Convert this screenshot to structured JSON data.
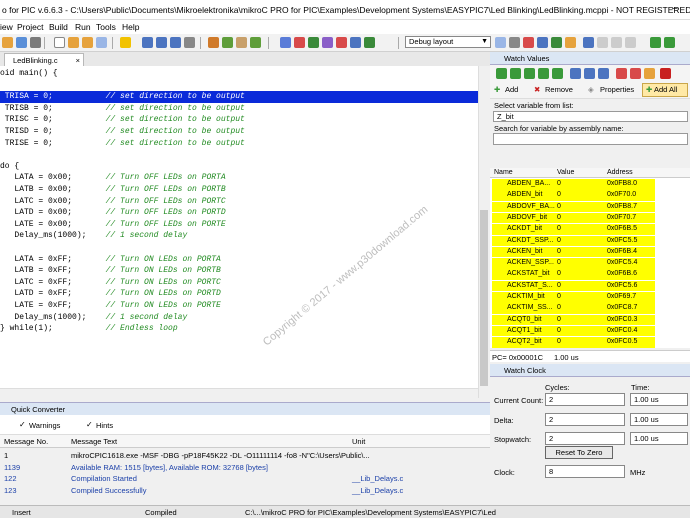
{
  "window": {
    "title": "o for PIC v.6.6.3 - C:\\Users\\Public\\Documents\\Mikroelektronika\\mikroC PRO for PIC\\Examples\\Development Systems\\EASYPIC7\\Led Blinking\\LedBlinking.mcppi - NOT REGISTERED"
  },
  "menu": [
    "iew",
    "Project",
    "Build",
    "Run",
    "Tools",
    "Help"
  ],
  "toolbar": {
    "layout_value": "Debug layout"
  },
  "editor": {
    "tab": "LedBlinking.c",
    "lines": [
      {
        "code": "oid main() {",
        "comment": ""
      },
      {
        "code": "",
        "comment": ""
      },
      {
        "code": " TRISA = 0;           ",
        "comment": "// set direction to be output"
      },
      {
        "code": " TRISB = 0;           ",
        "comment": "// set direction to be output"
      },
      {
        "code": " TRISC = 0;           ",
        "comment": "// set direction to be output"
      },
      {
        "code": " TRISD = 0;           ",
        "comment": "// set direction to be output"
      },
      {
        "code": " TRISE = 0;           ",
        "comment": "// set direction to be output"
      },
      {
        "code": "",
        "comment": ""
      },
      {
        "code": "do {",
        "comment": ""
      },
      {
        "code": "   LATA = 0x00;       ",
        "comment": "// Turn OFF LEDs on PORTA"
      },
      {
        "code": "   LATB = 0x00;       ",
        "comment": "// Turn OFF LEDs on PORTB"
      },
      {
        "code": "   LATC = 0x00;       ",
        "comment": "// Turn OFF LEDs on PORTC"
      },
      {
        "code": "   LATD = 0x00;       ",
        "comment": "// Turn OFF LEDs on PORTD"
      },
      {
        "code": "   LATE = 0x00;       ",
        "comment": "// Turn OFF LEDs on PORTE"
      },
      {
        "code": "   Delay_ms(1000);    ",
        "comment": "// 1 second delay"
      },
      {
        "code": "",
        "comment": ""
      },
      {
        "code": "   LATA = 0xFF;       ",
        "comment": "// Turn ON LEDs on PORTA"
      },
      {
        "code": "   LATB = 0xFF;       ",
        "comment": "// Turn ON LEDs on PORTB"
      },
      {
        "code": "   LATC = 0xFF;       ",
        "comment": "// Turn ON LEDs on PORTC"
      },
      {
        "code": "   LATD = 0xFF;       ",
        "comment": "// Turn ON LEDs on PORTD"
      },
      {
        "code": "   LATE = 0xFF;       ",
        "comment": "// Turn ON LEDs on PORTE"
      },
      {
        "code": "   Delay_ms(1000);    ",
        "comment": "// 1 second delay"
      },
      {
        "code": "} while(1);           ",
        "comment": "// Endless loop"
      }
    ],
    "highlighted_line": 2
  },
  "watermark": "Copyright © 2017 - www.p30download.com",
  "quick_converter": {
    "title": "Quick Converter",
    "warnings": "Warnings",
    "hints": "Hints"
  },
  "messages": {
    "headers": [
      "Message No.",
      "Message Text",
      "Unit"
    ],
    "rows": [
      {
        "no": "1",
        "text": "mikroCPIC1618.exe -MSF -DBG -pP18F45K22 -DL -O11111114 -fo8 -N\"C:\\Users\\Public\\...",
        "unit": "",
        "color": "#000000"
      },
      {
        "no": "1139",
        "text": "Available RAM: 1515 [bytes], Available ROM: 32768 [bytes]",
        "unit": "",
        "color": "#1a3fa8"
      },
      {
        "no": "122",
        "text": "Compilation Started",
        "unit": "__Lib_Delays.c",
        "color": "#1a3fa8"
      },
      {
        "no": "123",
        "text": "Compiled Successfully",
        "unit": "__Lib_Delays.c",
        "color": "#1a3fa8"
      }
    ]
  },
  "status": {
    "mode": "Insert",
    "state": "Compiled",
    "path": "C:\\...\\mikroC PRO for PIC\\Examples\\Development Systems\\EASYPIC7\\Led"
  },
  "watch": {
    "title": "Watch Values",
    "add": "Add",
    "remove": "Remove",
    "properties": "Properties",
    "add_all": "Add All",
    "select_label": "Select variable from list:",
    "select_value": "Z_bit",
    "search_label": "Search for variable by assembly name:",
    "headers": [
      "Name",
      "Value",
      "Address"
    ],
    "rows": [
      [
        "ABDEN_BA...",
        "0",
        "0x0FB8.0"
      ],
      [
        "ABDEN_bit",
        "0",
        "0x0F70.0"
      ],
      [
        "ABDOVF_BA...",
        "0",
        "0x0FB8.7"
      ],
      [
        "ABDOVF_bit",
        "0",
        "0x0F70.7"
      ],
      [
        "ACKDT_bit",
        "0",
        "0x0F6B.5"
      ],
      [
        "ACKDT_SSP...",
        "0",
        "0x0FC5.5"
      ],
      [
        "ACKEN_bit",
        "0",
        "0x0F6B.4"
      ],
      [
        "ACKEN_SSP...",
        "0",
        "0x0FC5.4"
      ],
      [
        "ACKSTAT_bit",
        "0",
        "0x0F6B.6"
      ],
      [
        "ACKSTAT_S...",
        "0",
        "0x0FC5.6"
      ],
      [
        "ACKTIM_bit",
        "0",
        "0x0F69.7"
      ],
      [
        "ACKTIM_SS...",
        "0",
        "0x0FC8.7"
      ],
      [
        "ACQT0_bit",
        "0",
        "0x0FC0.3"
      ],
      [
        "ACQT1_bit",
        "0",
        "0x0FC0.4"
      ],
      [
        "ACQT2_bit",
        "0",
        "0x0FC0.5"
      ]
    ],
    "pc_label": "PC= 0x00001C",
    "pc_time": "1.00 us"
  },
  "clock": {
    "title": "Watch Clock",
    "cycles_header": "Cycles:",
    "time_header": "Time:",
    "current_label": "Current Count:",
    "current_cycles": "2",
    "current_time": "1.00 us",
    "delta_label": "Delta:",
    "delta_cycles": "2",
    "delta_time": "1.00 us",
    "stopwatch_label": "Stopwatch:",
    "stopwatch_cycles": "2",
    "stopwatch_time": "1.00 us",
    "reset": "Reset To Zero",
    "clock_label": "Clock:",
    "clock_value": "8",
    "clock_unit": "MHz"
  }
}
